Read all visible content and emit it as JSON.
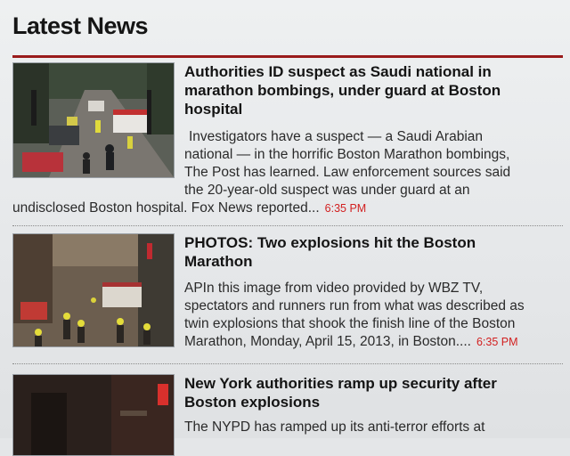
{
  "section_title": "Latest News",
  "articles": [
    {
      "headline": "Authorities ID suspect as Saudi national in marathon bombings, under guard at Boston hospital",
      "summary_lines": [
        "Investigators have a suspect — a Saudi Arabian",
        "national — in the horrific Boston Marathon bombings,",
        "The Post has learned. Law enforcement sources said",
        "the 20-year-old suspect was under guard at an",
        "undisclosed Boston hospital. Fox News reported..."
      ],
      "time": "6:35 PM"
    },
    {
      "headline": "PHOTOS: Two explosions hit the Boston Marathon",
      "summary_lines": [
        "APIn this image from video provided by WBZ TV,",
        "spectators and runners run from what was described as",
        "twin explosions that shook the finish line of the Boston",
        "Marathon, Monday, April 15, 2013, in Boston...."
      ],
      "time": "6:35 PM"
    },
    {
      "headline": "New York authorities ramp up security after Boston explosions",
      "summary_lines": [
        "The NYPD has ramped up its anti-terror efforts at"
      ],
      "time": ""
    }
  ]
}
